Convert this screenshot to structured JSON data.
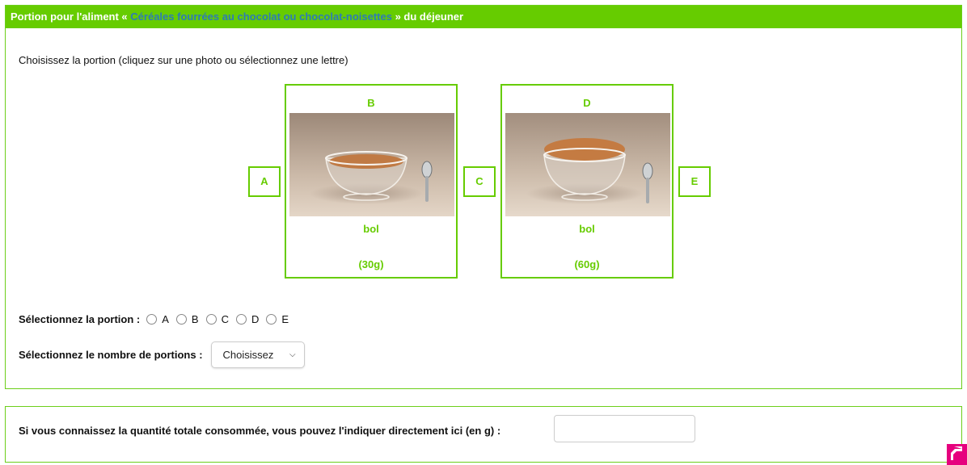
{
  "header": {
    "prefix": "Portion pour l'aliment «",
    "food_name": "Céréales fourrées au chocolat ou chocolat-noisettes",
    "suffix": "» du déjeuner"
  },
  "instructions": "Choisissez la portion (cliquez sur une photo ou sélectionnez une lettre)",
  "cards": [
    {
      "letter": "B",
      "unit": "bol",
      "weight": "(30g)",
      "cereal_amount": 0.5
    },
    {
      "letter": "D",
      "unit": "bol",
      "weight": "(60g)",
      "cereal_amount": 1.0
    }
  ],
  "letter_boxes": [
    "A",
    "C",
    "E"
  ],
  "portion_select": {
    "label": "Sélectionnez la portion :",
    "options": [
      "A",
      "B",
      "C",
      "D",
      "E"
    ]
  },
  "count_select": {
    "label": "Sélectionnez le nombre de portions :",
    "value": "Choisissez"
  },
  "total": {
    "label": "Si vous connaissez la quantité totale consommée, vous pouvez l'indiquer directement ici (en g) :",
    "value": ""
  },
  "colors": {
    "accent_green": "#66cc00",
    "food_link_blue": "#2e7bb6",
    "scroll_button": "#e6007e"
  },
  "icons": {
    "scroll_top": "arrow-up-icon",
    "select_chevron": "chevron-down-icon"
  }
}
